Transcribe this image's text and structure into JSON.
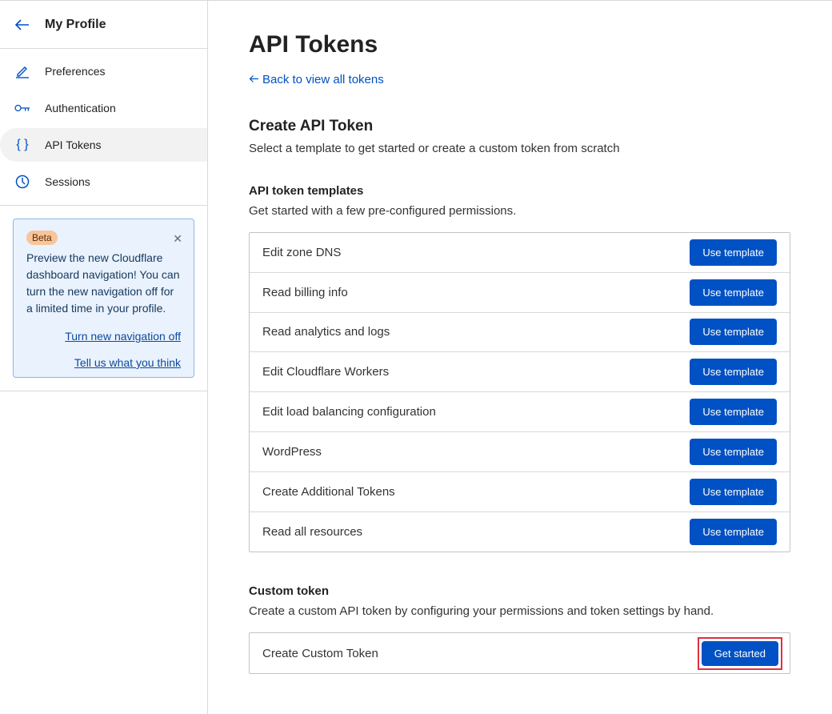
{
  "sidebar": {
    "title": "My Profile",
    "back_icon": "arrow-left-icon",
    "items": [
      {
        "label": "Preferences",
        "icon": "pencil-icon",
        "active": false
      },
      {
        "label": "Authentication",
        "icon": "key-icon",
        "active": false
      },
      {
        "label": "API Tokens",
        "icon": "braces-icon",
        "active": true
      },
      {
        "label": "Sessions",
        "icon": "clock-icon",
        "active": false
      }
    ],
    "beta": {
      "badge": "Beta",
      "text": "Preview the new Cloudflare dashboard navigation! You can turn the new navigation off for a limited time in your profile.",
      "link_off": "Turn new navigation off",
      "link_feedback": "Tell us what you think"
    }
  },
  "main": {
    "title": "API Tokens",
    "back_link": "Back to view all tokens",
    "create_title": "Create API Token",
    "create_subtitle": "Select a template to get started or create a custom token from scratch",
    "templates_title": "API token templates",
    "templates_subtitle": "Get started with a few pre-configured permissions.",
    "template_button": "Use template",
    "templates": [
      "Edit zone DNS",
      "Read billing info",
      "Read analytics and logs",
      "Edit Cloudflare Workers",
      "Edit load balancing configuration",
      "WordPress",
      "Create Additional Tokens",
      "Read all resources"
    ],
    "custom_title": "Custom token",
    "custom_subtitle": "Create a custom API token by configuring your permissions and token settings by hand.",
    "custom_row": "Create Custom Token",
    "custom_button": "Get started"
  },
  "colors": {
    "accent": "#0051c3",
    "highlight": "#e0303f",
    "beta_bg": "#e9f2fd",
    "badge_bg": "#f8c59b"
  }
}
